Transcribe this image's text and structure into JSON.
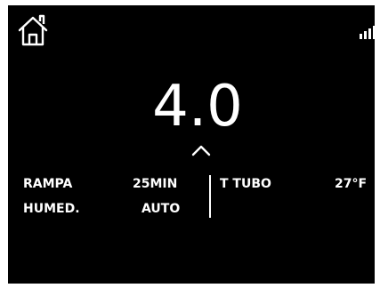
{
  "display": {
    "main_value": "4.0"
  },
  "info": {
    "ramp_label": "RAMPA",
    "ramp_value": "25MIN",
    "humidity_label": "HUMED.",
    "humidity_value": "AUTO",
    "pipe_label": "T TUBO",
    "pipe_value": "27°F"
  },
  "icons": {
    "home": "home-icon",
    "signal": "signal-strength-icon",
    "up": "chevron-up-icon"
  },
  "colors": {
    "background": "#000000",
    "foreground": "#ffffff"
  }
}
